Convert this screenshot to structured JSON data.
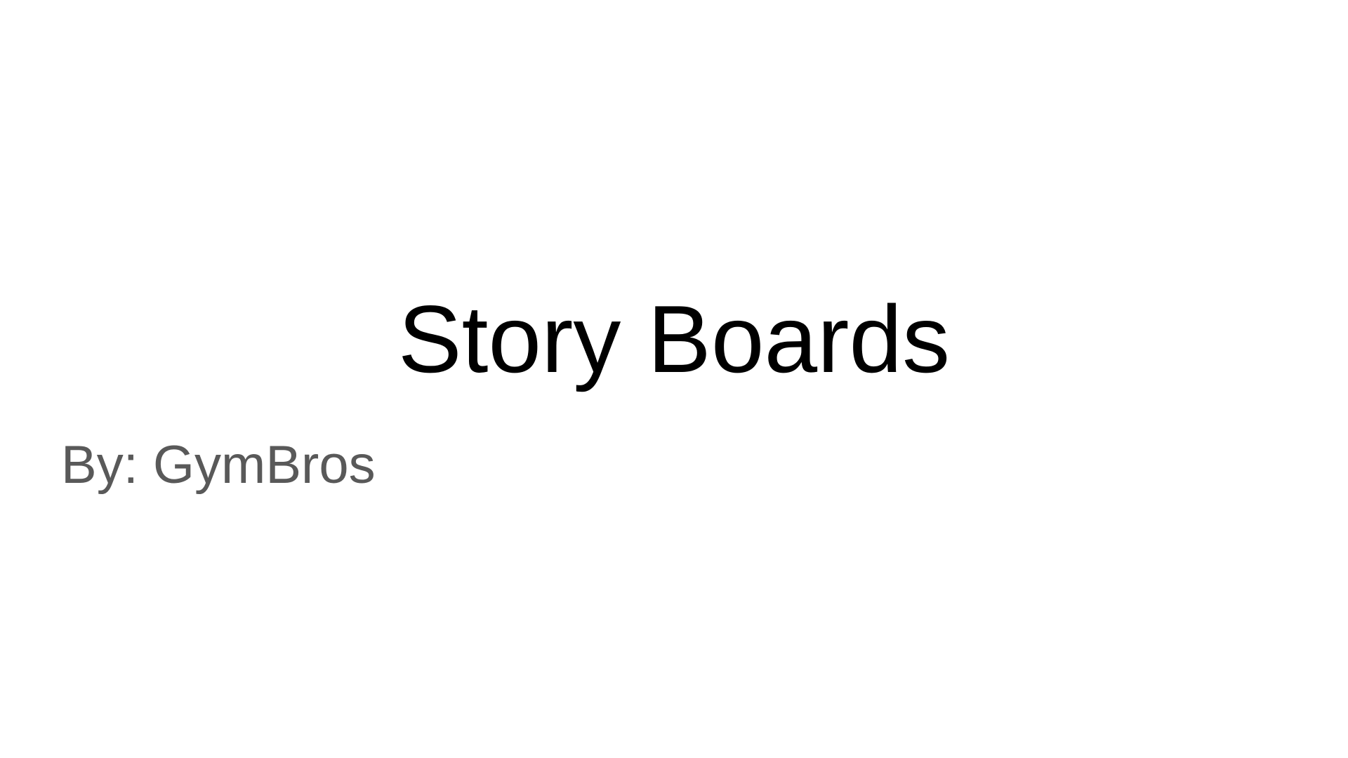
{
  "slide": {
    "title": "Story Boards",
    "subtitle": "By: GymBros",
    "colors": {
      "background": "#ffffff",
      "title": "#000000",
      "subtitle": "#595959"
    }
  }
}
